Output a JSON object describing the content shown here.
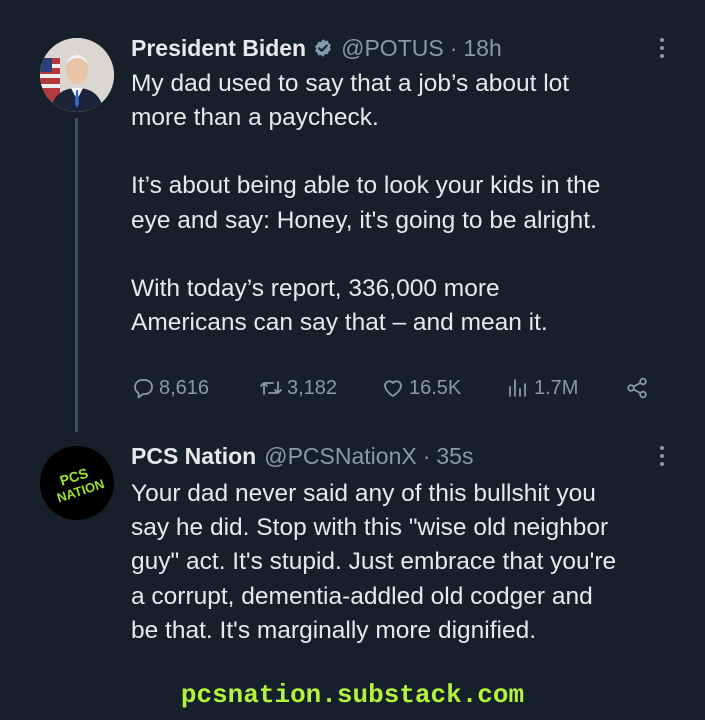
{
  "tweets": [
    {
      "name": "President Biden",
      "handle": "@POTUS",
      "separator": "·",
      "time": "18h",
      "lines": [
        "My dad used to say that a job’s about lot",
        "more than a paycheck.",
        "",
        "It’s about being able to look your kids in the",
        "eye and say: Honey, it's going to be alright.",
        "",
        "With today’s report, 336,000 more",
        "Americans can say that – and mean it."
      ],
      "stats": {
        "replies": "8,616",
        "retweets": "3,182",
        "likes": "16.5K",
        "views": "1.7M"
      }
    },
    {
      "name": "PCS Nation",
      "handle": "@PCSNationX",
      "separator": "·",
      "time": "35s",
      "avatar_text": [
        "PCS",
        "NATION"
      ],
      "lines": [
        "Your dad never said any of this bullshit you",
        "say he did. Stop with this \"wise old neighbor",
        "guy\" act. It's stupid. Just embrace that you're",
        "a corrupt, dementia-addled old codger and",
        "be that. It's marginally more dignified."
      ]
    }
  ],
  "footer": {
    "text": "pcsnation.substack.com"
  },
  "colors": {
    "background": "#15202b",
    "text": "#e7e9ea",
    "muted": "#8b98a5",
    "verified": "#829aab",
    "footer": "#b5f23c"
  },
  "icons": [
    "verified-badge-icon",
    "more-icon",
    "reply-icon",
    "retweet-icon",
    "like-icon",
    "views-icon",
    "share-icon"
  ]
}
